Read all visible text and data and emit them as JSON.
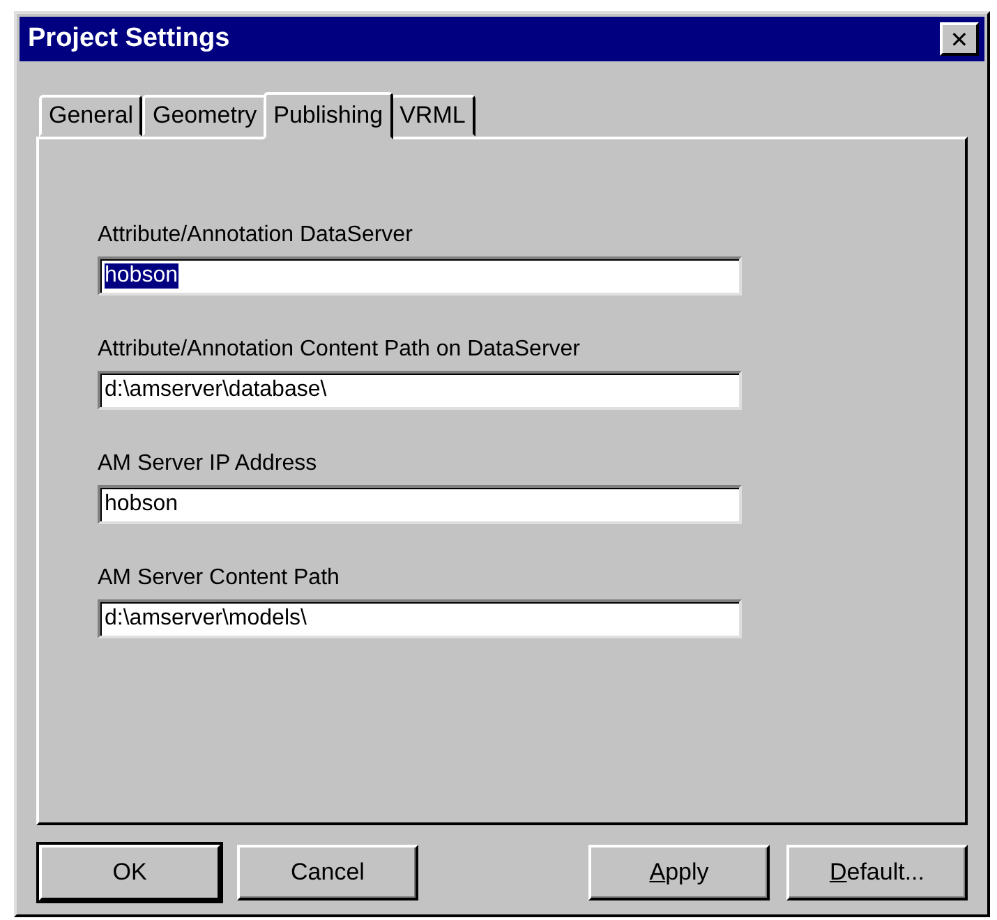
{
  "window": {
    "title": "Project Settings",
    "close": "✕"
  },
  "tabs": [
    {
      "label": "General",
      "selected": false
    },
    {
      "label": "Geometry",
      "selected": false
    },
    {
      "label": "Publishing",
      "selected": true
    },
    {
      "label": "VRML",
      "selected": false
    }
  ],
  "fields": [
    {
      "label": "Attribute/Annotation DataServer",
      "value": "hobson",
      "selected": true
    },
    {
      "label": "Attribute/Annotation Content Path on DataServer",
      "value": "d:\\amserver\\database\\",
      "selected": false
    },
    {
      "label": "AM Server IP Address",
      "value": "hobson",
      "selected": false
    },
    {
      "label": "AM Server Content Path",
      "value": "d:\\amserver\\models\\",
      "selected": false
    }
  ],
  "buttons": [
    {
      "rest": "OK",
      "default": true
    },
    {
      "rest": "Cancel",
      "default": false
    },
    {
      "mnemonic": "A",
      "rest": "pply",
      "default": false
    },
    {
      "mnemonic": "D",
      "rest": "efault...",
      "default": false
    }
  ]
}
